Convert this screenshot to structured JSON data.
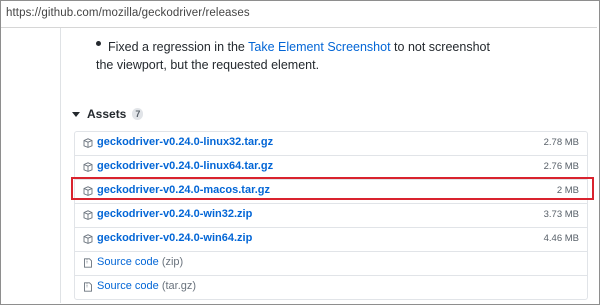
{
  "browser": {
    "url": "https://github.com/mozilla/geckodriver/releases"
  },
  "release_note": {
    "line1_prefix": "Fixed a regression in the ",
    "line1_link": "Take Element Screenshot",
    "line1_suffix": " to not screenshot",
    "line2": "the viewport, but the requested element."
  },
  "assets": {
    "heading": "Assets",
    "count": "7",
    "files": [
      {
        "name": "geckodriver-v0.24.0-linux32.tar.gz",
        "size": "2.78 MB",
        "icon": "package-icon"
      },
      {
        "name": "geckodriver-v0.24.0-linux64.tar.gz",
        "size": "2.76 MB",
        "icon": "package-icon"
      },
      {
        "name": "geckodriver-v0.24.0-macos.tar.gz",
        "size": "2 MB",
        "icon": "package-icon",
        "highlighted": true
      },
      {
        "name": "geckodriver-v0.24.0-win32.zip",
        "size": "3.73 MB",
        "icon": "package-icon"
      },
      {
        "name": "geckodriver-v0.24.0-win64.zip",
        "size": "4.46 MB",
        "icon": "package-icon"
      }
    ],
    "sources": [
      {
        "label": "Source code",
        "format": "(zip)",
        "icon": "file-zip-icon"
      },
      {
        "label": "Source code",
        "format": "(tar.gz)",
        "icon": "file-zip-icon"
      }
    ]
  },
  "colors": {
    "link": "#0366d6",
    "highlight": "#d9232e"
  }
}
